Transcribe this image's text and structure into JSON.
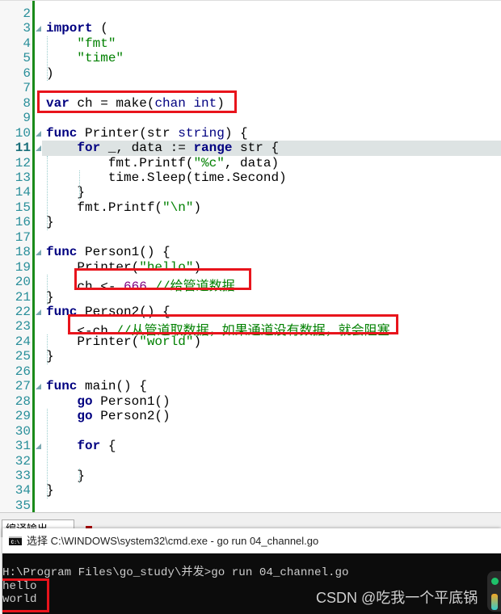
{
  "editor": {
    "current_line": 11,
    "lines": [
      {
        "n": "2",
        "indent": 0,
        "tokens": []
      },
      {
        "n": "3",
        "fold": true,
        "tokens": [
          [
            "import",
            "kw"
          ],
          [
            " (",
            ""
          ]
        ]
      },
      {
        "n": "4",
        "tokens": [
          [
            "    ",
            ""
          ],
          [
            "\"fmt\"",
            "str"
          ]
        ]
      },
      {
        "n": "5",
        "tokens": [
          [
            "    ",
            ""
          ],
          [
            "\"time\"",
            "str"
          ]
        ]
      },
      {
        "n": "6",
        "tokens": [
          [
            ")",
            ""
          ]
        ]
      },
      {
        "n": "7",
        "tokens": []
      },
      {
        "n": "8",
        "tokens": [
          [
            "var",
            "kw"
          ],
          [
            " ch = make(",
            ""
          ],
          [
            "chan",
            "ty"
          ],
          [
            " ",
            ""
          ],
          [
            "int",
            "ty"
          ],
          [
            ")",
            ""
          ]
        ]
      },
      {
        "n": "9",
        "tokens": []
      },
      {
        "n": "10",
        "fold": true,
        "tokens": [
          [
            "func",
            "kw"
          ],
          [
            " Printer(str ",
            ""
          ],
          [
            "string",
            "ty"
          ],
          [
            ") {",
            ""
          ]
        ]
      },
      {
        "n": "11",
        "fold": true,
        "tokens": [
          [
            "    ",
            ""
          ],
          [
            "for",
            "kw"
          ],
          [
            " _, data := ",
            ""
          ],
          [
            "range",
            "kw"
          ],
          [
            " str {",
            ""
          ]
        ]
      },
      {
        "n": "12",
        "tokens": [
          [
            "        fmt.Printf(",
            ""
          ],
          [
            "\"%c\"",
            "str"
          ],
          [
            ", data)",
            ""
          ]
        ]
      },
      {
        "n": "13",
        "tokens": [
          [
            "        time.Sleep(time.Second)",
            ""
          ]
        ]
      },
      {
        "n": "14",
        "tokens": [
          [
            "    }",
            ""
          ]
        ]
      },
      {
        "n": "15",
        "tokens": [
          [
            "    fmt.Printf(",
            ""
          ],
          [
            "\"\\n\"",
            "str"
          ],
          [
            ")",
            ""
          ]
        ]
      },
      {
        "n": "16",
        "tokens": [
          [
            "}",
            ""
          ]
        ]
      },
      {
        "n": "17",
        "tokens": []
      },
      {
        "n": "18",
        "fold": true,
        "tokens": [
          [
            "func",
            "kw"
          ],
          [
            " Person1() {",
            ""
          ]
        ]
      },
      {
        "n": "19",
        "tokens": [
          [
            "    Printer(",
            ""
          ],
          [
            "\"hello\"",
            "str"
          ],
          [
            ")",
            ""
          ]
        ]
      },
      {
        "n": "20",
        "tokens": [
          [
            "    ch <- ",
            ""
          ],
          [
            "666",
            "num"
          ],
          [
            " ",
            ""
          ],
          [
            "//给管道数据",
            "cmt"
          ]
        ]
      },
      {
        "n": "21",
        "tokens": [
          [
            "}",
            ""
          ]
        ]
      },
      {
        "n": "22",
        "fold": true,
        "tokens": [
          [
            "func",
            "kw"
          ],
          [
            " Person2() {",
            ""
          ]
        ]
      },
      {
        "n": "23",
        "tokens": [
          [
            "    <-ch ",
            ""
          ],
          [
            "//从管道取数据，如果通道没有数据，就会阻塞",
            "cmt"
          ]
        ]
      },
      {
        "n": "24",
        "tokens": [
          [
            "    Printer(",
            ""
          ],
          [
            "\"world\"",
            "str"
          ],
          [
            ")",
            ""
          ]
        ]
      },
      {
        "n": "25",
        "tokens": [
          [
            "}",
            ""
          ]
        ]
      },
      {
        "n": "26",
        "tokens": []
      },
      {
        "n": "27",
        "fold": true,
        "tokens": [
          [
            "func",
            "kw"
          ],
          [
            " main() {",
            ""
          ]
        ]
      },
      {
        "n": "28",
        "tokens": [
          [
            "    ",
            ""
          ],
          [
            "go",
            "kw"
          ],
          [
            " Person1()",
            ""
          ]
        ]
      },
      {
        "n": "29",
        "tokens": [
          [
            "    ",
            ""
          ],
          [
            "go",
            "kw"
          ],
          [
            " Person2()",
            ""
          ]
        ]
      },
      {
        "n": "30",
        "tokens": []
      },
      {
        "n": "31",
        "fold": true,
        "tokens": [
          [
            "    ",
            ""
          ],
          [
            "for",
            "kw"
          ],
          [
            " {",
            ""
          ]
        ]
      },
      {
        "n": "32",
        "tokens": []
      },
      {
        "n": "33",
        "tokens": [
          [
            "    }",
            ""
          ]
        ]
      },
      {
        "n": "34",
        "tokens": [
          [
            "}",
            ""
          ]
        ]
      },
      {
        "n": "35",
        "tokens": []
      }
    ]
  },
  "output_panel": {
    "dropdown_label": "编译输出"
  },
  "cmd": {
    "title": "选择 C:\\WINDOWS\\system32\\cmd.exe - go  run 04_channel.go",
    "icon": "C:\\",
    "lines": [
      "H:\\Program Files\\go_study\\并发>go run 04_channel.go",
      "hello",
      "world"
    ]
  },
  "watermark": "CSDN @吃我一个平底锅",
  "colors": {
    "highlight_box": "#e8141c",
    "keyword": "#000080",
    "string": "#008000",
    "number": "#800080"
  }
}
